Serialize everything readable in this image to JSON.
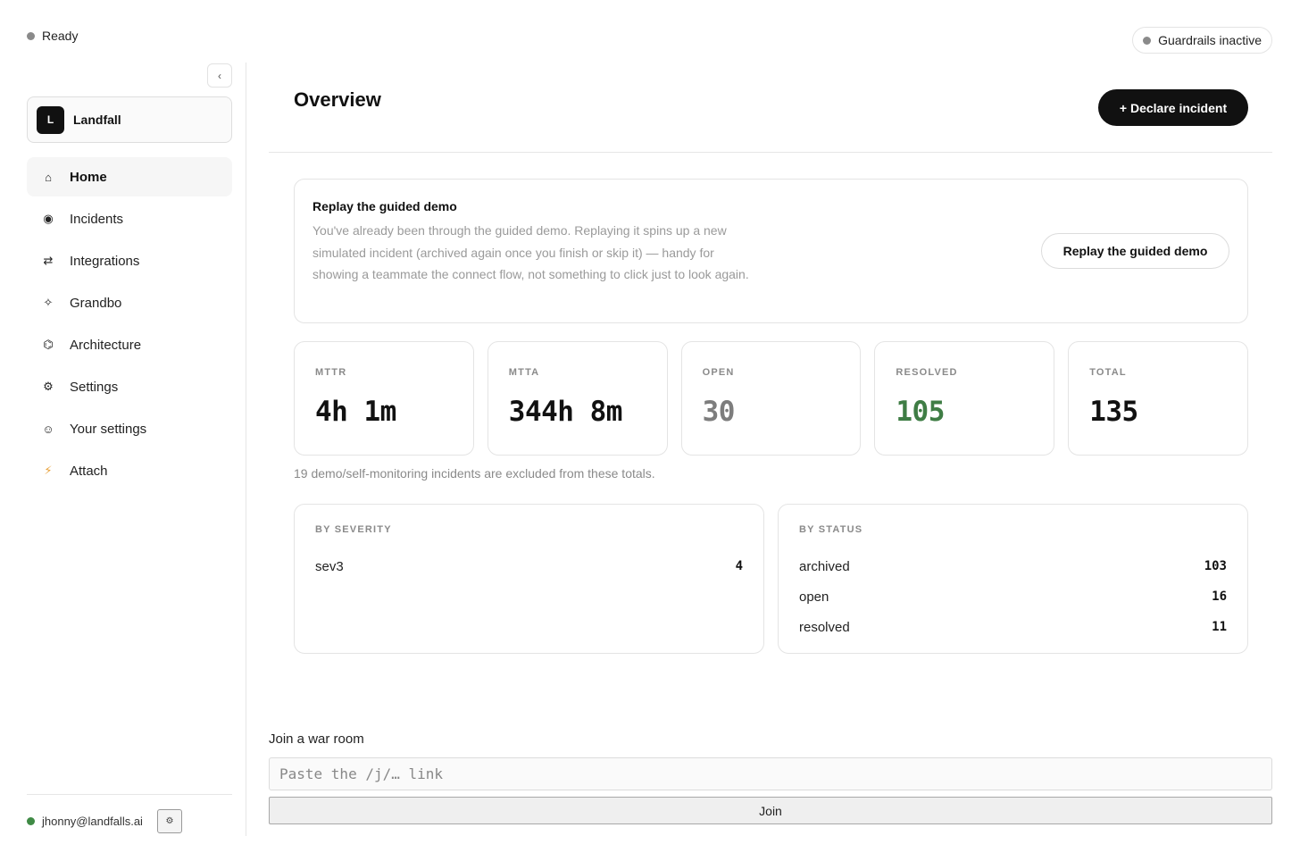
{
  "status": {
    "label": "Ready",
    "color": "#8a8a8a"
  },
  "guardrails": {
    "label": "Guardrails inactive",
    "color": "#8a8a8a"
  },
  "sidebar": {
    "collapse_glyph": "‹",
    "workspace": {
      "initial": "L",
      "name": "Landfall"
    },
    "items": [
      {
        "label": "Home",
        "icon": "⌂",
        "icon_name": "home-icon",
        "active": true
      },
      {
        "label": "Incidents",
        "icon": "◉",
        "icon_name": "incident-icon",
        "active": false
      },
      {
        "label": "Integrations",
        "icon": "⇄",
        "icon_name": "integrations-icon",
        "active": false
      },
      {
        "label": "Grandbo",
        "icon": "✧",
        "icon_name": "sparkle-icon",
        "active": false
      },
      {
        "label": "Architecture",
        "icon": "⌬",
        "icon_name": "architecture-icon",
        "active": false
      },
      {
        "label": "Settings",
        "icon": "⚙",
        "icon_name": "gear-icon",
        "active": false
      },
      {
        "label": "Your settings",
        "icon": "☺",
        "icon_name": "user-icon",
        "active": false
      },
      {
        "label": "Attach",
        "icon": "⚡",
        "icon_name": "bolt-icon",
        "active": false
      }
    ],
    "user": {
      "email": "jhonny@landfalls.ai",
      "status_color": "#3f8a45",
      "gear_glyph": "⚙"
    }
  },
  "header": {
    "title": "Overview",
    "declare_label": "+ Declare incident"
  },
  "demo": {
    "title": "Replay the guided demo",
    "text": "You've already been through the guided demo. Replaying it spins up a new simulated incident (archived again once you finish or skip it) — handy for showing a teammate the connect flow, not something to click just to look again.",
    "button_label": "Replay the guided demo"
  },
  "metrics": [
    {
      "label": "MTTR",
      "value": "4h 1m",
      "tone": "default"
    },
    {
      "label": "MTTA",
      "value": "344h 8m",
      "tone": "default"
    },
    {
      "label": "OPEN",
      "value": "30",
      "tone": "grey"
    },
    {
      "label": "RESOLVED",
      "value": "105",
      "tone": "green"
    },
    {
      "label": "TOTAL",
      "value": "135",
      "tone": "default"
    }
  ],
  "excluded_note": "19 demo/self-monitoring incidents are excluded from these totals.",
  "by_severity": {
    "label": "BY SEVERITY",
    "rows": [
      {
        "name": "sev3",
        "count": "4"
      }
    ]
  },
  "by_status": {
    "label": "BY STATUS",
    "rows": [
      {
        "name": "archived",
        "count": "103"
      },
      {
        "name": "open",
        "count": "16"
      },
      {
        "name": "resolved",
        "count": "11"
      }
    ]
  },
  "war_room": {
    "label": "Join a war room",
    "placeholder": "Paste the /j/… link",
    "value": "",
    "join_label": "Join"
  },
  "colors": {
    "green_value": "#3f7d45",
    "primary_button": "#111111"
  }
}
